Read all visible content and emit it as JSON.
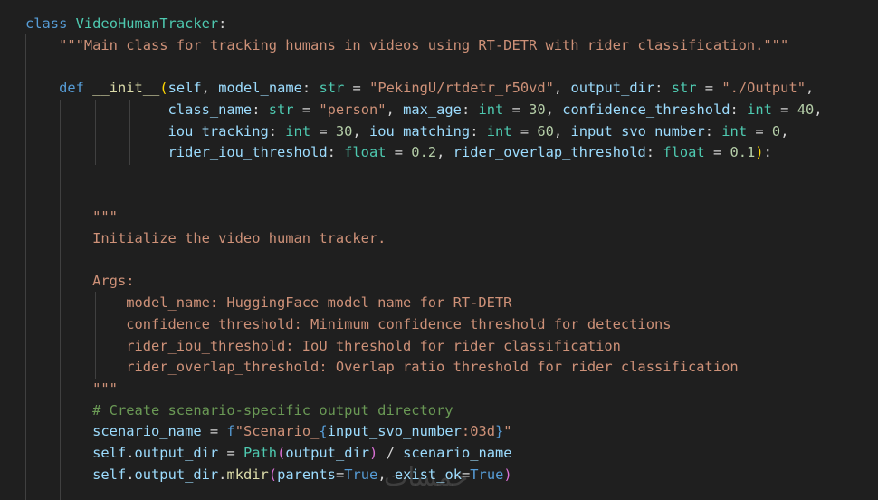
{
  "editor": {
    "theme": {
      "background": "#1f1f1f",
      "guide": "#404040"
    },
    "lines": [
      [
        {
          "t": "class",
          "c": "keyword"
        },
        {
          "t": " ",
          "c": "punct"
        },
        {
          "t": "VideoHumanTracker",
          "c": "class"
        },
        {
          "t": ":",
          "c": "punct"
        }
      ],
      [
        {
          "t": "    ",
          "c": "punct"
        },
        {
          "t": "\"\"\"Main class for tracking humans in videos using RT-DETR with rider classification.\"\"\"",
          "c": "string"
        }
      ],
      [],
      [
        {
          "t": "    ",
          "c": "punct"
        },
        {
          "t": "def",
          "c": "keyword"
        },
        {
          "t": " ",
          "c": "punct"
        },
        {
          "t": "__init__",
          "c": "func"
        },
        {
          "t": "(",
          "c": "bracket"
        },
        {
          "t": "self",
          "c": "param"
        },
        {
          "t": ", ",
          "c": "punct"
        },
        {
          "t": "model_name",
          "c": "param"
        },
        {
          "t": ": ",
          "c": "punct"
        },
        {
          "t": "str",
          "c": "class"
        },
        {
          "t": " = ",
          "c": "punct"
        },
        {
          "t": "\"PekingU/rtdetr_r50vd\"",
          "c": "string"
        },
        {
          "t": ", ",
          "c": "punct"
        },
        {
          "t": "output_dir",
          "c": "param"
        },
        {
          "t": ": ",
          "c": "punct"
        },
        {
          "t": "str",
          "c": "class"
        },
        {
          "t": " = ",
          "c": "punct"
        },
        {
          "t": "\"./Output\"",
          "c": "string"
        },
        {
          "t": ",",
          "c": "punct"
        }
      ],
      [
        {
          "t": "                 ",
          "c": "punct"
        },
        {
          "t": "class_name",
          "c": "param"
        },
        {
          "t": ": ",
          "c": "punct"
        },
        {
          "t": "str",
          "c": "class"
        },
        {
          "t": " = ",
          "c": "punct"
        },
        {
          "t": "\"person\"",
          "c": "string"
        },
        {
          "t": ", ",
          "c": "punct"
        },
        {
          "t": "max_age",
          "c": "param"
        },
        {
          "t": ": ",
          "c": "punct"
        },
        {
          "t": "int",
          "c": "class"
        },
        {
          "t": " = ",
          "c": "punct"
        },
        {
          "t": "30",
          "c": "number"
        },
        {
          "t": ", ",
          "c": "punct"
        },
        {
          "t": "confidence_threshold",
          "c": "param"
        },
        {
          "t": ": ",
          "c": "punct"
        },
        {
          "t": "int",
          "c": "class"
        },
        {
          "t": " = ",
          "c": "punct"
        },
        {
          "t": "40",
          "c": "number"
        },
        {
          "t": ",",
          "c": "punct"
        }
      ],
      [
        {
          "t": "                 ",
          "c": "punct"
        },
        {
          "t": "iou_tracking",
          "c": "param"
        },
        {
          "t": ": ",
          "c": "punct"
        },
        {
          "t": "int",
          "c": "class"
        },
        {
          "t": " = ",
          "c": "punct"
        },
        {
          "t": "30",
          "c": "number"
        },
        {
          "t": ", ",
          "c": "punct"
        },
        {
          "t": "iou_matching",
          "c": "param"
        },
        {
          "t": ": ",
          "c": "punct"
        },
        {
          "t": "int",
          "c": "class"
        },
        {
          "t": " = ",
          "c": "punct"
        },
        {
          "t": "60",
          "c": "number"
        },
        {
          "t": ", ",
          "c": "punct"
        },
        {
          "t": "input_svo_number",
          "c": "param"
        },
        {
          "t": ": ",
          "c": "punct"
        },
        {
          "t": "int",
          "c": "class"
        },
        {
          "t": " = ",
          "c": "punct"
        },
        {
          "t": "0",
          "c": "number"
        },
        {
          "t": ",",
          "c": "punct"
        }
      ],
      [
        {
          "t": "                 ",
          "c": "punct"
        },
        {
          "t": "rider_iou_threshold",
          "c": "param"
        },
        {
          "t": ": ",
          "c": "punct"
        },
        {
          "t": "float",
          "c": "class"
        },
        {
          "t": " = ",
          "c": "punct"
        },
        {
          "t": "0.2",
          "c": "number"
        },
        {
          "t": ", ",
          "c": "punct"
        },
        {
          "t": "rider_overlap_threshold",
          "c": "param"
        },
        {
          "t": ": ",
          "c": "punct"
        },
        {
          "t": "float",
          "c": "class"
        },
        {
          "t": " = ",
          "c": "punct"
        },
        {
          "t": "0.1",
          "c": "number"
        },
        {
          "t": ")",
          "c": "bracket"
        },
        {
          "t": ":",
          "c": "punct"
        }
      ],
      [],
      [],
      [
        {
          "t": "        ",
          "c": "punct"
        },
        {
          "t": "\"\"\"",
          "c": "string"
        }
      ],
      [
        {
          "t": "        ",
          "c": "punct"
        },
        {
          "t": "Initialize the video human tracker.",
          "c": "string"
        }
      ],
      [],
      [
        {
          "t": "        ",
          "c": "punct"
        },
        {
          "t": "Args:",
          "c": "string"
        }
      ],
      [
        {
          "t": "            ",
          "c": "punct"
        },
        {
          "t": "model_name: HuggingFace model name for RT-DETR",
          "c": "string"
        }
      ],
      [
        {
          "t": "            ",
          "c": "punct"
        },
        {
          "t": "confidence_threshold: Minimum confidence threshold for detections",
          "c": "string"
        }
      ],
      [
        {
          "t": "            ",
          "c": "punct"
        },
        {
          "t": "rider_iou_threshold: IoU threshold for rider classification",
          "c": "string"
        }
      ],
      [
        {
          "t": "            ",
          "c": "punct"
        },
        {
          "t": "rider_overlap_threshold: Overlap ratio threshold for rider classification",
          "c": "string"
        }
      ],
      [
        {
          "t": "        ",
          "c": "punct"
        },
        {
          "t": "\"\"\"",
          "c": "string"
        }
      ],
      [
        {
          "t": "        ",
          "c": "punct"
        },
        {
          "t": "# Create scenario-specific output directory",
          "c": "comment"
        }
      ],
      [
        {
          "t": "        ",
          "c": "punct"
        },
        {
          "t": "scenario_name",
          "c": "var"
        },
        {
          "t": " = ",
          "c": "punct"
        },
        {
          "t": "f",
          "c": "keyword"
        },
        {
          "t": "\"Scenario_",
          "c": "string"
        },
        {
          "t": "{",
          "c": "brace"
        },
        {
          "t": "input_svo_number",
          "c": "var"
        },
        {
          "t": ":03d",
          "c": "string"
        },
        {
          "t": "}",
          "c": "brace"
        },
        {
          "t": "\"",
          "c": "string"
        }
      ],
      [
        {
          "t": "        ",
          "c": "punct"
        },
        {
          "t": "self",
          "c": "var"
        },
        {
          "t": ".",
          "c": "punct"
        },
        {
          "t": "output_dir",
          "c": "var"
        },
        {
          "t": " = ",
          "c": "punct"
        },
        {
          "t": "Path",
          "c": "class"
        },
        {
          "t": "(",
          "c": "paren"
        },
        {
          "t": "output_dir",
          "c": "var"
        },
        {
          "t": ")",
          "c": "paren"
        },
        {
          "t": " / ",
          "c": "punct"
        },
        {
          "t": "scenario_name",
          "c": "var"
        }
      ],
      [
        {
          "t": "        ",
          "c": "punct"
        },
        {
          "t": "self",
          "c": "var"
        },
        {
          "t": ".",
          "c": "punct"
        },
        {
          "t": "output_dir",
          "c": "var"
        },
        {
          "t": ".",
          "c": "punct"
        },
        {
          "t": "mkdir",
          "c": "func"
        },
        {
          "t": "(",
          "c": "paren"
        },
        {
          "t": "parents",
          "c": "param"
        },
        {
          "t": "=",
          "c": "punct"
        },
        {
          "t": "True",
          "c": "const"
        },
        {
          "t": ", ",
          "c": "punct"
        },
        {
          "t": "exist_ok",
          "c": "param"
        },
        {
          "t": "=",
          "c": "punct"
        },
        {
          "t": "True",
          "c": "const"
        },
        {
          "t": ")",
          "c": "paren"
        }
      ]
    ]
  },
  "watermark": {
    "text": "خمسات"
  }
}
